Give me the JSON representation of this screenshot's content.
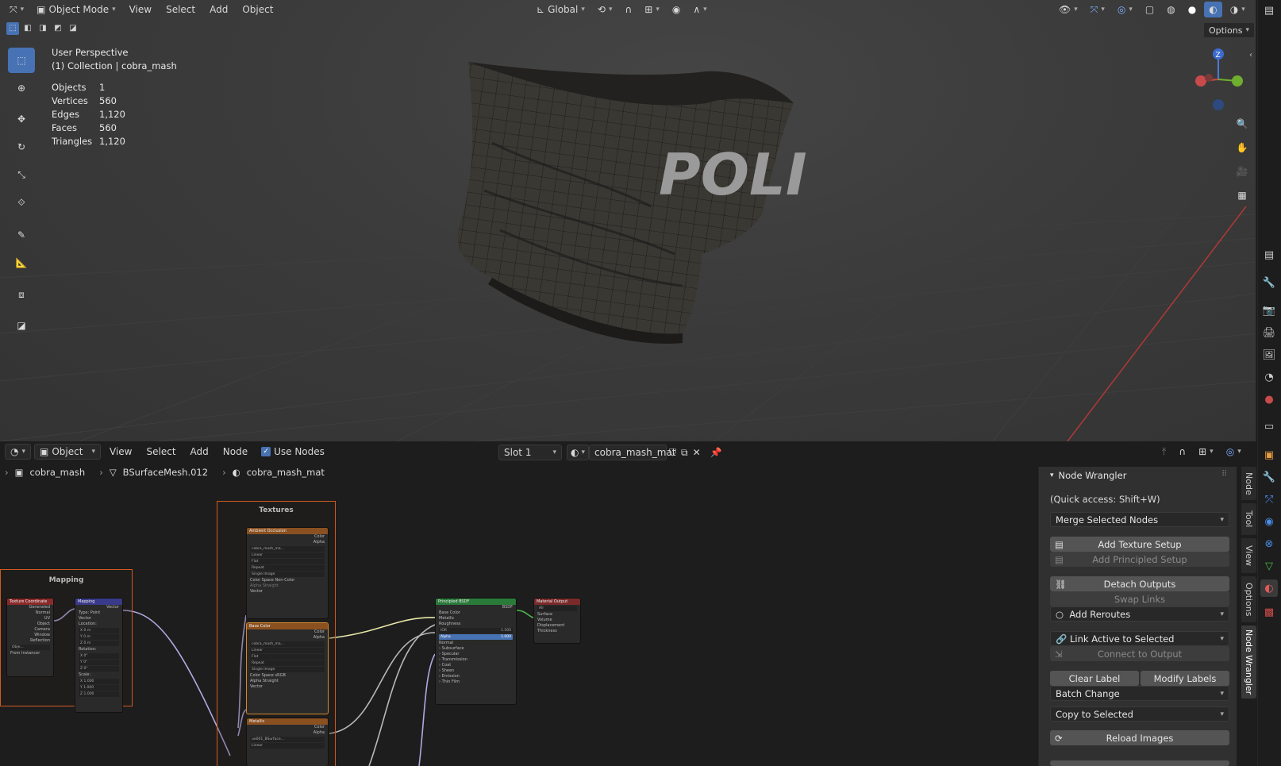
{
  "viewport": {
    "header": {
      "mode": "Object Mode",
      "menus": [
        "View",
        "Select",
        "Add",
        "Object"
      ],
      "orientation": "Global",
      "options": "Options"
    },
    "overlay": {
      "perspective": "User Perspective",
      "collection": "(1) Collection | cobra_mash",
      "stats": [
        {
          "label": "Objects",
          "value": "1"
        },
        {
          "label": "Vertices",
          "value": "560"
        },
        {
          "label": "Edges",
          "value": "1,120"
        },
        {
          "label": "Faces",
          "value": "560"
        },
        {
          "label": "Triangles",
          "value": "1,120"
        }
      ]
    },
    "mask_text": "POLI",
    "gizmo": {
      "z": "Z"
    }
  },
  "node_editor": {
    "header": {
      "mode": "Object",
      "menus": [
        "View",
        "Select",
        "Add",
        "Node"
      ],
      "use_nodes": "Use Nodes",
      "slot": "Slot 1",
      "material": "cobra_mash_mat"
    },
    "breadcrumb": [
      "cobra_mash",
      "BSurfaceMesh.012",
      "cobra_mash_mat"
    ],
    "frames": {
      "mapping": "Mapping",
      "textures": "Textures"
    },
    "nodes": {
      "texcoord": {
        "title": "Texture Coordinate",
        "outputs": [
          "Generated",
          "Normal",
          "UV",
          "Object",
          "Camera",
          "Window",
          "Reflection"
        ],
        "object_label": "Obje...",
        "instancer": "From Instancer"
      },
      "mapping": {
        "title": "Mapping",
        "out": "Vector",
        "type_label": "Type:",
        "type_val": "Point",
        "vector": "Vector",
        "location": "Location:",
        "rotation": "Rotation:",
        "scale": "Scale:",
        "loc": [
          [
            "X",
            "0 m"
          ],
          [
            "Y",
            "0 m"
          ],
          [
            "Z",
            "0 m"
          ]
        ],
        "rot": [
          [
            "X",
            "0°"
          ],
          [
            "Y",
            "0°"
          ],
          [
            "Z",
            "0°"
          ]
        ],
        "scl": [
          [
            "X",
            "1.000"
          ],
          [
            "Y",
            "1.000"
          ],
          [
            "Z",
            "1.000"
          ]
        ]
      },
      "ao": {
        "title": "Ambient Occlusion",
        "color": "Color",
        "alpha": "Alpha",
        "image": "cobra_mash_ma...",
        "fields": [
          "Linear",
          "Flat",
          "Repeat",
          "Single Image"
        ],
        "cs_label": "Color Space",
        "cs_val": "Non-Color",
        "alpha_label": "Alpha",
        "alpha_val": "Straight",
        "vector": "Vector"
      },
      "base": {
        "title": "Base Color",
        "color": "Color",
        "alpha": "Alpha",
        "image": "cobra_mash_ma...",
        "fields": [
          "Linear",
          "Flat",
          "Repeat",
          "Single Image"
        ],
        "cs_label": "Color Space",
        "cs_val": "sRGB",
        "alpha_label": "Alpha",
        "alpha_val": "Straight",
        "vector": "Vector"
      },
      "metal": {
        "title": "Metallic",
        "color": "Color",
        "alpha": "Alpha",
        "image": "ue001_BSurface...",
        "fields": [
          "Linear"
        ]
      },
      "bsdf": {
        "title": "Principled BSDF",
        "out": "BSDF",
        "inputs": [
          "Base Color",
          "Metallic",
          "Roughness"
        ],
        "ior_label": "IOR",
        "ior_val": "1.500",
        "alpha_label": "Alpha",
        "alpha_val": "1.000",
        "normal": "Normal",
        "panels": [
          "Subsurface",
          "Specular",
          "Transmission",
          "Coat",
          "Sheen",
          "Emission",
          "Thin Film"
        ]
      },
      "output": {
        "title": "Material Output",
        "target": "All",
        "inputs": [
          "Surface",
          "Volume",
          "Displacement",
          "Thickness"
        ]
      }
    },
    "wrangler": {
      "title": "Node Wrangler",
      "quick": "(Quick access: Shift+W)",
      "merge": "Merge Selected Nodes",
      "add_texture": "Add Texture Setup",
      "add_principled": "Add Principled Setup",
      "detach": "Detach Outputs",
      "swap": "Swap Links",
      "reroutes": "Add Reroutes",
      "link_active": "Link Active to Selected",
      "connect_output": "Connect to Output",
      "clear_label": "Clear Label",
      "modify_labels": "Modify Labels",
      "batch": "Batch Change",
      "copy": "Copy to Selected",
      "reload": "Reload Images"
    },
    "tabs": [
      "Node",
      "Tool",
      "View",
      "Options",
      "Node Wrangler"
    ]
  }
}
